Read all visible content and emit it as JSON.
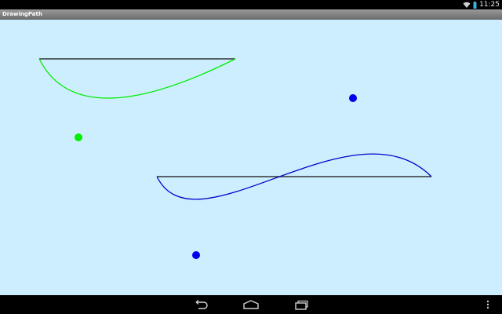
{
  "status_bar": {
    "time": "11:25",
    "icons": [
      "wifi-icon",
      "battery-icon"
    ]
  },
  "app": {
    "title": "DrawingPath"
  },
  "canvas": {
    "background": "#cdeefe",
    "baseline_color": "#333333",
    "curves": [
      {
        "name": "green-curve",
        "color": "#00ee00"
      },
      {
        "name": "blue-curve",
        "color": "#0000cc"
      }
    ],
    "control_points": [
      {
        "name": "green-control-point",
        "color": "#00ee00"
      },
      {
        "name": "blue-control-point-1",
        "color": "#0000ee"
      },
      {
        "name": "blue-control-point-2",
        "color": "#0000ee"
      }
    ]
  },
  "nav_bar": {
    "buttons": [
      "back-icon",
      "home-icon",
      "recent-apps-icon",
      "menu-icon"
    ]
  }
}
